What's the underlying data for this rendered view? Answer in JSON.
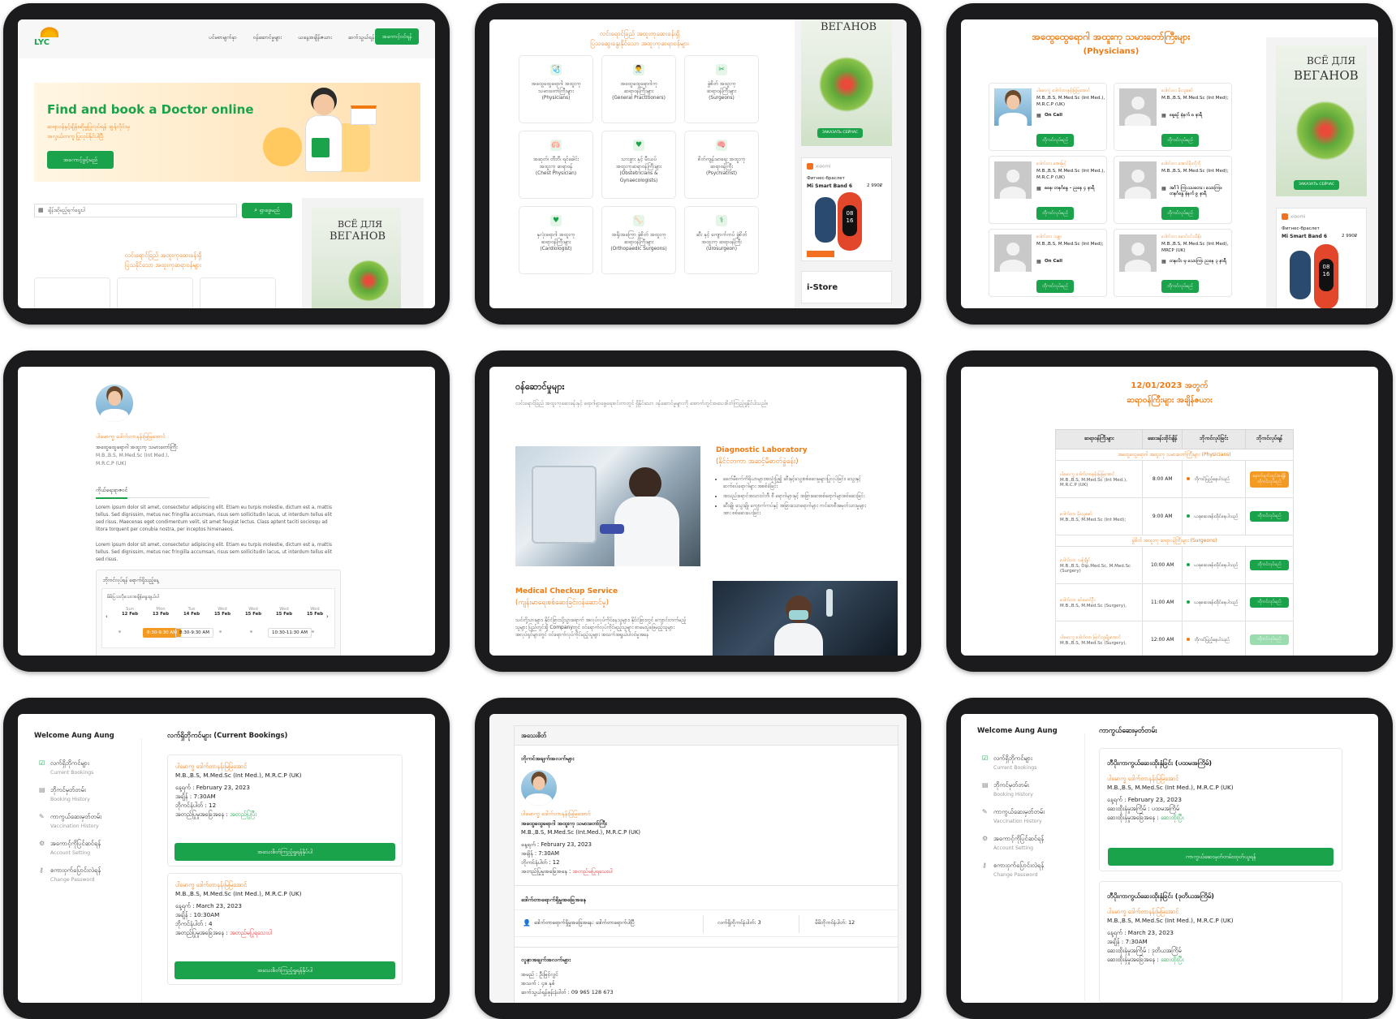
{
  "colors": {
    "accent": "#f07a12",
    "primary": "#1aa34a",
    "danger": "#e0262b"
  },
  "home": {
    "logo": "LYC",
    "nav": [
      "ပင်မစာမျက်နှာ",
      "ဝန်ဆောင်မှုများ",
      "ယနေ့အချိန်ဇယား",
      "ဆက်သွယ်ရန်"
    ],
    "cta": "အကောင့်ဝင်ရန်",
    "hero_title": "Find and book a Doctor online",
    "hero_sub_1": "ဆရာဝန်နှင့်ချိန်းဆိုမှုပြုလုပ်ရန် အွန်လိုင်းမှ",
    "hero_sub_2": "အလွယ်တကူ ပြုလုပ်နိုင်ပါပြီ",
    "hero_btn": "အကောင့်ဖွင့်မည်",
    "search_placeholder": "ချိန်းဆိုမည့်ရက်ရွေးပါ",
    "search_btn": "ရှာဖွေမည်",
    "section_title_1": "လင်းရောင်ခြည် အထူးကုဆေးခန်းရှိ",
    "section_title_2": "ပြသနိုင်သော အထူးကုဆရာဝန်များ"
  },
  "services_grid": {
    "title_1": "လင်းရောင်ခြည် အထူးကုဆေးခန်းရှိ",
    "title_2": "ပြသဆွေးနွေးနိုင်သော အထူးကုဆရာဝန်များ",
    "items": [
      {
        "l1": "အထွေထွေရောဂါ အထူးကု",
        "l2": "သမားတော်ကြီးများ",
        "l3": "(Physicians)",
        "icon": "🩺"
      },
      {
        "l1": "အထွေထွေရောဂါကု",
        "l2": "ဆရာဝန်ကြီးများ",
        "l3": "(General Practitioners)",
        "icon": "👨‍⚕️"
      },
      {
        "l1": "ခွဲစိတ် အထူးကု",
        "l2": "ဆရာဝန်ကြီးများ",
        "l3": "(Surgeons)",
        "icon": "✂"
      },
      {
        "l1": "အဆုတ်၊ တီဘီ၊ ရင်ခေါင်း",
        "l2": "အထူးကု ဆရာဝန်",
        "l3": "(Chest Physician)",
        "icon": "🫁"
      },
      {
        "l1": "သားဖွား နှင့် မီးယပ်",
        "l2": "အထူးကုဆရာဝန်ကြီးများ",
        "l3": "(Obstetricians & Gynaecologists)",
        "icon": "♥"
      },
      {
        "l1": "စိတ်ကျန်းမာရေး အထူးကု",
        "l2": "ဆရာဝန်ကြီး",
        "l3": "(Psychiatrist)",
        "icon": "🧠"
      },
      {
        "l1": "နှလုံးရောဂါ အထူးကု",
        "l2": "ဆရာဝန်ကြီးများ",
        "l3": "(Cardiologist)",
        "icon": "♥"
      },
      {
        "l1": "အရိုးအကြော ခွဲစိတ် အထူးကု",
        "l2": "ဆရာဝန်ကြီးများ",
        "l3": "(Orthopaedic Surgeons)",
        "icon": "🦴"
      },
      {
        "l1": "ဆီး နှင့် ကျောက်ကပ် ခွဲစိတ်",
        "l2": "အထူးကု ဆရာဝန်ကြီး",
        "l3": "(Urosurgeon)",
        "icon": "⚕"
      }
    ]
  },
  "ads": {
    "vegan_title_1": "ВСЁ ДЛЯ",
    "vegan_title_2": "ВЕГАНОВ",
    "vegan_btn": "ЗАКАЗАТЬ СЕЙЧАС",
    "band_brand": "xiaomi",
    "band_sub": "Фитнес-браслет",
    "band_name": "Mi Smart Band 6",
    "band_price": "2 990₽",
    "band_face_1": "08",
    "band_face_2": "16",
    "istore": "i-Store"
  },
  "physicians": {
    "title": "အထွေထွေရောဂါ အထူးကု သမားတော်ကြီးများ",
    "subtitle": "(Physicians)",
    "btn": "ဘိုကင်လုပ်မည်",
    "doctors": [
      {
        "name": "ပါမောက္ခ ဒေါက်တာနန်းမြမြအောင်",
        "deg": "M.B.,B.S, M.Med.Sc (Int Med.), M.R.C.P (UK)",
        "status": "On Call",
        "photo": true
      },
      {
        "name": "ဒေါက်တာ မိုးသူဇော်",
        "deg": "M.B.,B.S, M.Med.Sc (Int Med);",
        "status": "နေ့စဉ် နံနက် ၈ နာရီ",
        "photo": false
      },
      {
        "name": "ဒေါက်တာ အေးမြင့်",
        "deg": "M.B.,B.S, M.Med.Sc (Int Med.), M.R.C.P (UK)",
        "status": "စနေ၊ တနင်္ဂနွေ - ညနေ ၄ နာရီ",
        "photo": false
      },
      {
        "name": "ဒေါက်တာ အောင်မိုးကိုကို",
        "deg": "M.B.,B.S, M.Med.Sc (Int Med);",
        "status": "အင်္ဂါ၊ ကြာသပတေး ၊ သောကြာ၊ တနင်္ဂနွေ နံနက် ၉ နာရီ",
        "photo": false
      },
      {
        "name": "ဒေါက်တာ သန္တာ",
        "deg": "M.B.,B.S, M.Med.Sc (Int Med);",
        "status": "On Call",
        "photo": false
      },
      {
        "name": "ဒေါက်တာ မောင်ဝင်းသိန်း",
        "deg": "M.B.,B.S, M.Med.Sc (Int Med), MRCP (UK)",
        "status": "တနင်္လာ မှ သောကြာ ညနေ ၃ နာရီ",
        "photo": false
      }
    ]
  },
  "profile": {
    "name": "ပါမောက္ခ ဒေါက်တာနန်းမြမြအောင်",
    "title": "အထွေထွေရောဂါ အထူးကု သမားတော်ကြီး",
    "deg_1": "M.B.,B.S, M.Med.Sc (Int Med.),",
    "deg_2": "M.R.C.P (UK)",
    "tab": "ကိုယ်ရေးရာဇဝင်",
    "bio_1": "Lorem ipsum dolor sit amet, consectetur adipiscing elit. Etiam eu turpis molestie, dictum est a, mattis tellus. Sed dignissim, metus nec fringilla accumsan, risus sem sollicitudin lacus, ut interdum tellus elit sed risus. Maecenas eget condimentum velit, sit amet feugiat lectus. Class aptent taciti sociosqu ad litora torquent per conubia nostra, per inceptos himenaeos.",
    "bio_2": "Lorem ipsum dolor sit amet, consectetur adipiscing elit. Etiam eu turpis molestie, dictum est a, mattis tellus. Sed dignissim, metus nec fringilla accumsan, risus sem sollicitudin lacus, ut interdum tellus elit sed risus.",
    "booking_head": "ဘိုကင်လုပ်ရန် ရောက်ရှိသည့်နေ့",
    "booking_sub": "မိမိပြသလိုသောအချိန်ရွေးချယ်ပါ",
    "days": [
      {
        "d": "Sun",
        "n": "12 Feb"
      },
      {
        "d": "Mon",
        "n": "13 Feb"
      },
      {
        "d": "Tue",
        "n": "14 Feb"
      },
      {
        "d": "Wed",
        "n": "15 Feb"
      },
      {
        "d": "Wed",
        "n": "15 Feb"
      },
      {
        "d": "Wed",
        "n": "15 Feb"
      },
      {
        "d": "Wed",
        "n": "15 Feb"
      }
    ],
    "slots": [
      "8:30-9:30 AM",
      "8:30-9:30 AM",
      "10:30-11:30 AM"
    ]
  },
  "services": {
    "title": "ဝန်ဆောင်မှုများ",
    "intro": "လင်းရောင်ခြည် အထူးကုဆေးခန်းနှင့် ရောဂါရှာဖွေရေးစင်တာတွင် ရှိနိုင်သော ဝန်ဆောင်မှုများကို အောက်တွင်အသေးစိတ်ကြည့်ရှုနိုင်ပါသည်။",
    "lab_title": "Diagnostic Laboratory",
    "lab_sub": "(နိုင်ငံတကာ အဆင့်မီဓာတ်ခွဲခန်း)",
    "lab_points": [
      "ခေတ်မီစက်ကိရိယာများအသုံးပြု၍ ဆီးနှင့်သွေးစစ်ဆေးမှုများပြုလုပ်ခြင်း၊ သွေးနှင့်ဆက်စပ်ရောဂါများ အစစ်ခံခြင်း",
      "အသည်းရောင်အသားဝါဘီ၊ စီ ရောဂါများနှင့် အခြားဆေးစစ်ရောဂါများစစ်ဆေးခြင်း",
      "ဆီးချို၊ သွေးချို၊ ကျောက်ကပ်နှင့် အခြားသောရောဂါများ ကင်ဆာစီအမှတ်သားမှုများအား စစ်ဆေးပေးခြင်း"
    ],
    "checkup_title": "Medical Checkup Service",
    "checkup_sub": "(ကျန်းမာရေးစစ်ဆေးခြင်းဝန်ဆောင်မှု)",
    "checkup_text": "သင်တို့သားများ၊ နိုင်ငံခြားသို့သွားရောက် အလုပ်လုပ်ကိုင်နေသူများ၊ နိုင်ငံခြားတွင် ကျောင်းတက်မည့်သူများ ပြည်တွင်းရှိ Companyတွင် ဝင်ရောက်လုပ်ကိုင်မည့်သူများ စာမေးပွဲဖြေမည့်သူများ အလုပ်ရှင်များတွင် ဝင်ရောက်လုပ်ကိုင်မည့်သူများ အသက်အရွယ်ပါဝင်မှုအနေ"
  },
  "schedule": {
    "title_1": "12/01/2023 အတွက်",
    "title_2": "ဆရာဝန်ကြီးများ အချိန်ဇယား",
    "headers": [
      "ဆရာဝန်ကြီးများ",
      "ဆေးခန်းထိုင်ချိန်",
      "ဘိုကင်လုပ်ခြင်း",
      "ဘိုကင်လုပ်ရန်"
    ],
    "group_1": "အထွေထွေရောဂါ အထူးကု သမားတော်ကြီးများ (Physicians)",
    "group_2": "ခွဲစိတ် အထူးကု ဆရာဝန်ကြီးများ (Surgeons)",
    "rows": [
      {
        "name": "ပါမောက္ခ ဒေါက်တာနန်းမြမြအောင်",
        "deg": "M.B.,B.S, M.Med.Sc (Int Med.), M.R.C.P (UK)",
        "time": "8:00 AM",
        "status": "ဘိုကင်ပြည့်နေပါသည်",
        "dot": "#f07a12",
        "btn": "နောက်ရက်တွင်အချိန် ဘိုကင်လုပ်မည်",
        "btn_color": "#f39a22",
        "group": 1
      },
      {
        "name": "ဒေါက်တာ မိုးသူဇော်",
        "deg": "M.B.,B.S, M.Med.Sc (Int Med);",
        "time": "9:00 AM",
        "status": "ယခုဆေးခန်းထိုင်နေပါသည်",
        "dot": "#1aa34a",
        "btn": "ဘိုကင်လုပ်မည်",
        "btn_color": "#1aa34a",
        "group": 1
      },
      {
        "name": "ဒေါက်တာ သန့်ချိုင်",
        "deg": "M.B.,B.S, Dip.Med.Sc, M.Med.Sc (Surgery)",
        "time": "10:00 AM",
        "status": "ယခုဆေးခန်းထိုင်နေပါသည်",
        "dot": "#1aa34a",
        "btn": "ဘိုကင်လုပ်မည်",
        "btn_color": "#1aa34a",
        "group": 2
      },
      {
        "name": "ဒေါက်တာ ခင်မောင်ဦး",
        "deg": "M.B.,B.S, M.Med.Sc (Surgery),",
        "time": "11:00 AM",
        "status": "ယခုဆေးခန်းထိုင်နေပါသည်",
        "dot": "#1aa34a",
        "btn": "ဘိုကင်လုပ်မည်",
        "btn_color": "#1aa34a",
        "group": 2
      },
      {
        "name": "ပါမောက္ခ ဒေါက်တာ မြတ်သူမျိုးအောင်",
        "deg": "M.B.,B.S, M.Med.Sc (Surgery),",
        "time": "12:00 AM",
        "status": "ဘိုကင်ပြည့်နေပါသည်",
        "dot": "#f07a12",
        "btn": "ဘိုကင်လုပ်မည်",
        "btn_color": "#9bdcae",
        "group": 2
      }
    ]
  },
  "account": {
    "welcome": "Welcome Aung Aung",
    "menu": [
      {
        "mm": "လက်ရှိဘိုကင်များ",
        "en": "Current Bookings",
        "icon": "☑"
      },
      {
        "mm": "ဘိုကင်မှတ်တမ်း",
        "en": "Booking History",
        "icon": "▤"
      },
      {
        "mm": "ကာကွယ်ဆေးမှတ်တမ်း",
        "en": "Vaccination History",
        "icon": "✎"
      },
      {
        "mm": "အကောင့်ကိုပြင်ဆင်ရန်",
        "en": "Account Setting",
        "icon": "⚙"
      },
      {
        "mm": "စကားဝှက်ပြောင်းလဲရန်",
        "en": "Change Password",
        "icon": "⚷"
      }
    ],
    "current_title": "လက်ရှိဘိုကင်များ (Current Bookings)",
    "bookings": [
      {
        "name": "ပါမောက္ခ ဒေါက်တာနန်းမြမြအောင်",
        "deg": "M.B.,B.S, M.Med.Sc (Int Med.), M.R.C.P (UK)",
        "date": "နေ့ရက် : February 23, 2023",
        "time": "အချိန် : 7:30AM",
        "no": "ဘိုကင်နံပါတ် : 12",
        "status_label": "အတည်ပြုမှုအခြေအနေ : ",
        "status": "အတည်ပြုပြီး",
        "status_color": "#18a54a"
      },
      {
        "name": "ပါမောက္ခ ဒေါက်တာနန်းမြမြအောင်",
        "deg": "M.B.,B.S, M.Med.Sc (Int Med.), M.R.C.P (UK)",
        "date": "နေ့ရက် : March 23, 2023",
        "time": "အချိန် : 10:30AM",
        "no": "ဘိုကင်နံပါတ် : 4",
        "status_label": "အတည်ပြုမှုအခြေအနေ : ",
        "status": "အတည်မပြုရသေးပါ",
        "status_color": "#e0262b"
      }
    ],
    "detail_btn": "အသေးစိတ်ကြည့်ရှုရန်နှိပ်ပါ"
  },
  "detail": {
    "title": "အသေးစိတ်",
    "booking_info": "ဘိုကင်အချက်အလက်များ",
    "name": "ပါမောက္ခ ဒေါက်တာနန်းမြမြအောင်",
    "role": "အထွေထွေရောဂါ အထူးကု သမားတော်ကြီး",
    "deg": "M.B.,B.S, M.Med.Sc (Int.Med.), M.R.C.P (UK)",
    "date": "နေ့ရက် : February 23, 2023",
    "time": "အချိန် : 7:30AM",
    "no": "ဘိုကင်နံပါတ် : 12",
    "status_label": "အတည်ပြုမှုအခြေအနေ : ",
    "status": "အတည်မပြုရသေးပါ",
    "presence_title": "ဒေါက်တာရောက်ရှိမှုအခြေအနေ",
    "presence": "ဒေါက်တာရောက်ရှိမှုအခြေအနေ: ဒေါက်တာရောက်ပါပြီ",
    "current_no": "လက်ရှိဘိုကင်နံပါတ်: 3",
    "my_no": "မိမိဘိုကင်နံပါတ်: 12",
    "patient_title": "လူနာအချက်အလက်များ",
    "patient_name": "အမည် : ဦးမြင့်လွင်",
    "patient_age": "အသက် : ၄၈ နှစ်",
    "patient_phone": "ဆက်သွယ်ရန်ဖုန်းနံပါတ် : 09 965 128 673"
  },
  "vaccine": {
    "title": "ကာကွယ်ဆေးမှတ်တမ်း",
    "btn": "ကာကွယ်ဆေးမှတ်တမ်းထုတ်ယူရန်",
    "items": [
      {
        "head": "ဘီပိုးကာကွယ်ဆေးထိုးနှံခြင်း (ပထမအကြိမ်)",
        "name": "ပါမောက္ခ ဒေါက်တာနန်းမြမြအောင်",
        "deg": "M.B.,B.S, M.Med.Sc (Int Med.), M.R.C.P (UK)",
        "date": "နေ့ရက် : February 23, 2023",
        "dose": "ဆေးထိုးနှံမှုအကြိမ် : ပထမအကြိမ်",
        "status_label": "ဆေးထိုးနှံမှုအခြေအနေ : ",
        "status": "ဆေးထိုးပြီး"
      },
      {
        "head": "ဘီပိုးကာကွယ်ဆေးထိုးနှံခြင်း (ဒုတိယအကြိမ်)",
        "name": "ပါမောက္ခ ဒေါက်တာနန်းမြမြအောင်",
        "deg": "M.B.,B.S, M.Med.Sc (Int Med.), M.R.C.P (UK)",
        "date": "နေ့ရက် : March 23, 2023",
        "time": "အချိန် : 7:30AM",
        "dose": "ဆေးထိုးနှံမှုအကြိမ် : ဒုတိယအကြိမ်",
        "status_label": "ဆေးထိုးနှံမှုအခြေအနေ : ",
        "status": "ဆေးထိုးပြီး"
      }
    ]
  }
}
